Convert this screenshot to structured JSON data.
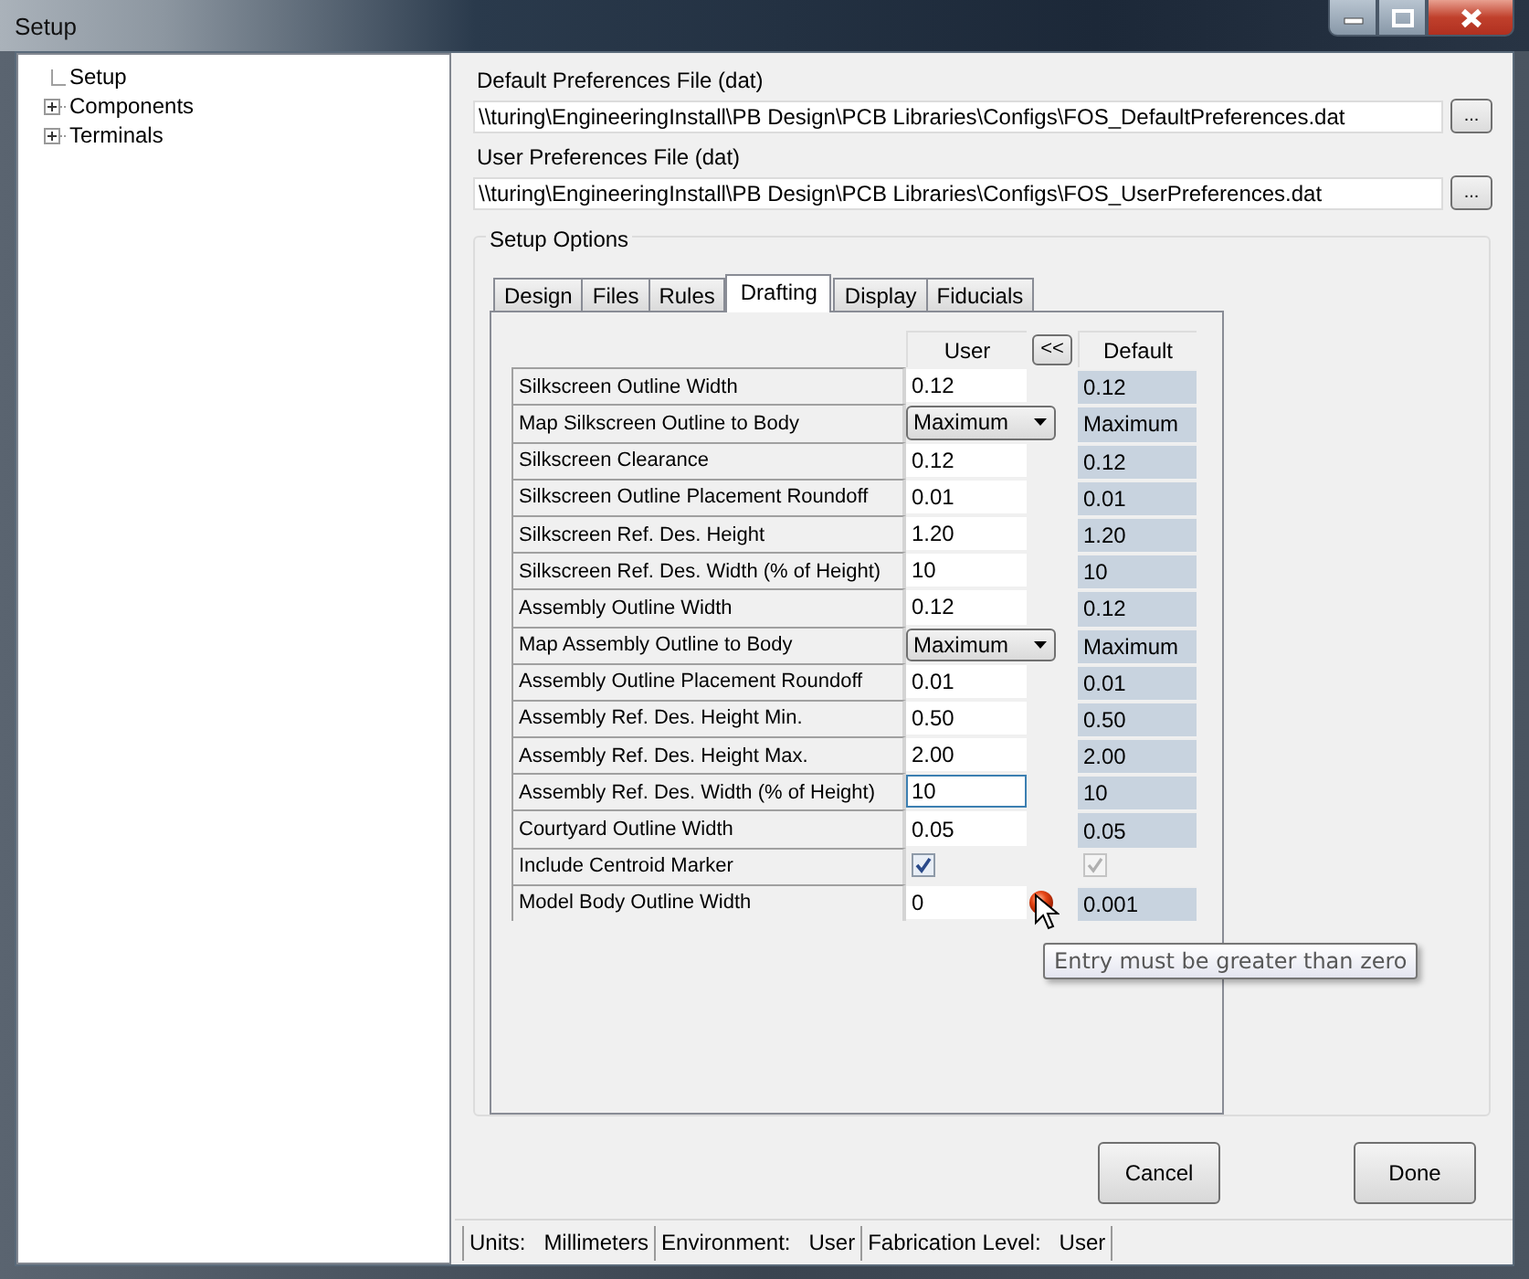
{
  "window": {
    "title": "Setup"
  },
  "tree": [
    {
      "label": "Setup",
      "kind": "leaf"
    },
    {
      "label": "Components",
      "kind": "branch"
    },
    {
      "label": "Terminals",
      "kind": "branch"
    }
  ],
  "default_file": {
    "label": "Default Preferences File  (dat)",
    "value": "\\\\turing\\EngineeringInstall\\PB Design\\PCB Libraries\\Configs\\FOS_DefaultPreferences.dat",
    "button": "..."
  },
  "user_file": {
    "label": "User Preferences File  (dat)",
    "value": "\\\\turing\\EngineeringInstall\\PB Design\\PCB Libraries\\Configs\\FOS_UserPreferences.dat",
    "button": "..."
  },
  "setup_options": {
    "title": "Setup Options",
    "tabs": [
      {
        "label": "Design",
        "selected": false
      },
      {
        "label": "Files",
        "selected": false
      },
      {
        "label": "Rules",
        "selected": false
      },
      {
        "label": "Drafting",
        "selected": true
      },
      {
        "label": "Display",
        "selected": false
      },
      {
        "label": "Fiducials",
        "selected": false
      }
    ],
    "columns": {
      "user": "User",
      "copy_button": "<<",
      "default": "Default"
    },
    "rows": [
      {
        "kind": "text",
        "label": "Silkscreen Outline Width",
        "user": "0.12",
        "default": "0.12",
        "focused": false,
        "error": false
      },
      {
        "kind": "dropdown",
        "label": "Map Silkscreen Outline to Body",
        "user": "Maximum",
        "default": "Maximum",
        "focused": false,
        "error": false
      },
      {
        "kind": "text",
        "label": "Silkscreen Clearance",
        "user": "0.12",
        "default": "0.12",
        "focused": false,
        "error": false
      },
      {
        "kind": "text",
        "label": "Silkscreen Outline Placement Roundoff",
        "user": "0.01",
        "default": "0.01",
        "focused": false,
        "error": false
      },
      {
        "kind": "text",
        "label": "Silkscreen Ref. Des. Height",
        "user": "1.20",
        "default": "1.20",
        "focused": false,
        "error": false
      },
      {
        "kind": "text",
        "label": "Silkscreen Ref. Des. Width (% of Height)",
        "user": "10",
        "default": "10",
        "focused": false,
        "error": false
      },
      {
        "kind": "text",
        "label": "Assembly Outline Width",
        "user": "0.12",
        "default": "0.12",
        "focused": false,
        "error": false
      },
      {
        "kind": "dropdown",
        "label": "Map Assembly Outline to Body",
        "user": "Maximum",
        "default": "Maximum",
        "focused": false,
        "error": false
      },
      {
        "kind": "text",
        "label": "Assembly Outline Placement Roundoff",
        "user": "0.01",
        "default": "0.01",
        "focused": false,
        "error": false
      },
      {
        "kind": "text",
        "label": "Assembly Ref. Des.  Height Min.",
        "user": "0.50",
        "default": "0.50",
        "focused": false,
        "error": false
      },
      {
        "kind": "text",
        "label": "Assembly Ref. Des. Height Max.",
        "user": "2.00",
        "default": "2.00",
        "focused": false,
        "error": false
      },
      {
        "kind": "text",
        "label": "Assembly Ref. Des. Width (% of Height)",
        "user": "10",
        "default": "10",
        "focused": true,
        "error": false
      },
      {
        "kind": "text",
        "label": "Courtyard Outline Width",
        "user": "0.05",
        "default": "0.05",
        "focused": false,
        "error": false
      },
      {
        "kind": "checkbox",
        "label": "Include Centroid Marker",
        "user_checked": true,
        "default_checked": true,
        "focused": false,
        "error": false
      },
      {
        "kind": "text",
        "label": "Model Body Outline Width",
        "user": "0",
        "default": "0.001",
        "focused": false,
        "error": true
      }
    ],
    "tooltip": "Entry must be greater than zero"
  },
  "buttons": [
    {
      "label": "Cancel"
    },
    {
      "label": "Done"
    }
  ],
  "status_bar": [
    {
      "label": "Units:",
      "value": "Millimeters"
    },
    {
      "label": "Environment:",
      "value": "User"
    },
    {
      "label": "Fabrication Level:",
      "value": "User"
    }
  ]
}
